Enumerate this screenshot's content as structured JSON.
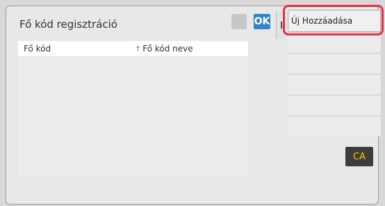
{
  "header": {
    "title": "Fő kód regisztráció",
    "ok_label": "OK"
  },
  "table": {
    "columns": [
      "Fő kód",
      "Fő kód neve"
    ]
  },
  "sidebar": {
    "add_label": "Új Hozzáadása"
  },
  "footer": {
    "ca_label": "CA"
  }
}
